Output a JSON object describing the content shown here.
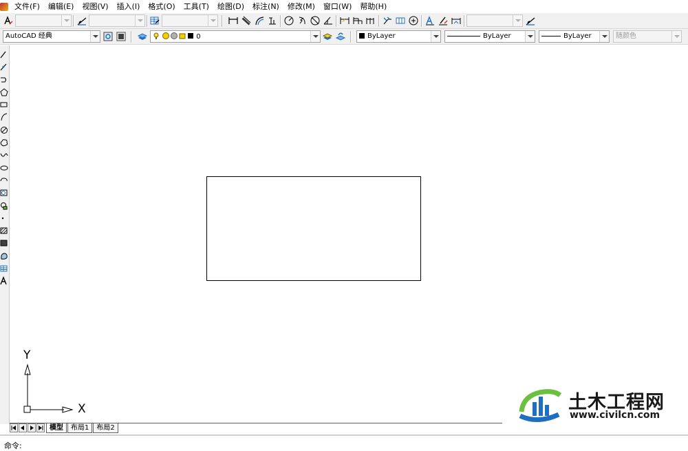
{
  "menu": {
    "items": [
      "文件(F)",
      "编辑(E)",
      "视图(V)",
      "插入(I)",
      "格式(O)",
      "工具(T)",
      "绘图(D)",
      "标注(N)",
      "修改(M)",
      "窗口(W)",
      "帮助(H)"
    ]
  },
  "toolbar_top": {
    "text_style_combo": "",
    "dim_style_combo": "",
    "table_style_combo": "",
    "multileader_style_combo": ""
  },
  "toolbar_props": {
    "workspace": "AutoCAD 经典",
    "layer_name": "0",
    "color": "ByLayer",
    "linetype": "ByLayer",
    "lineweight": "ByLayer",
    "plot_style": "随颜色"
  },
  "ucs": {
    "x_label": "X",
    "y_label": "Y"
  },
  "tabs": [
    "模型",
    "布局1",
    "布局2"
  ],
  "command": {
    "prompt": "命令:"
  },
  "watermark": {
    "title": "土木工程网",
    "url": "www.civilcn.com"
  },
  "colors": {
    "accent_blue": "#1f6fc0",
    "accent_green": "#6cc040",
    "toolbar_bg": "#f0f0f0"
  }
}
